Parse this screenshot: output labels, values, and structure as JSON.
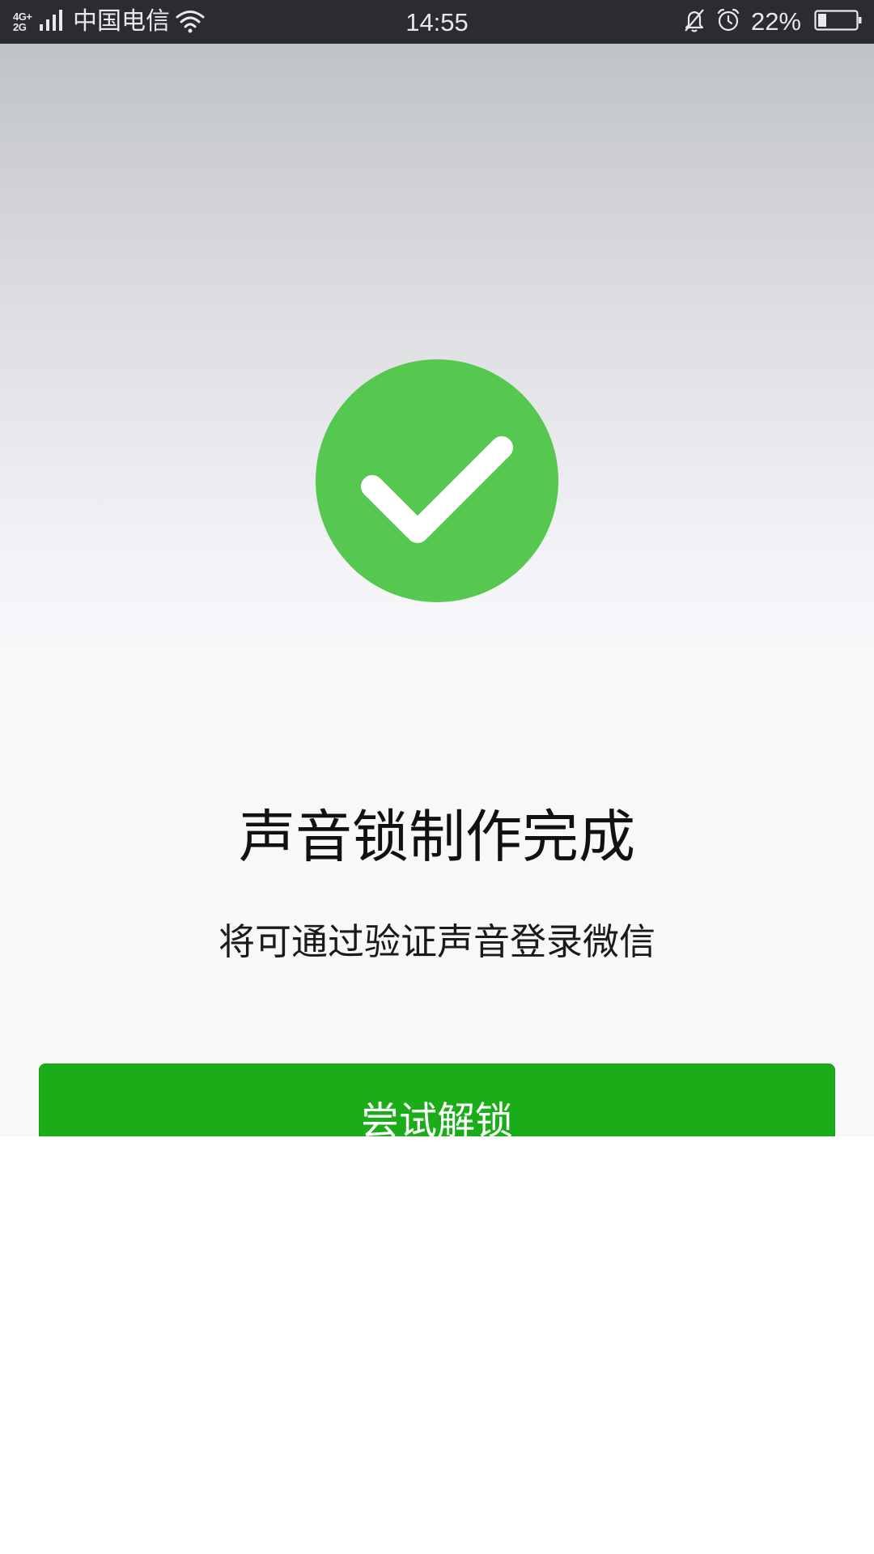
{
  "status_bar": {
    "network_top": "4G+",
    "network_bottom": "2G",
    "carrier": "中国电信",
    "time": "14:55",
    "battery_percent": "22%",
    "battery_level": 0.22,
    "icons": [
      "signal-icon",
      "wifi-icon",
      "bell-muted-icon",
      "alarm-icon",
      "battery-icon"
    ]
  },
  "content": {
    "success_icon": "check-circle-icon",
    "success_color": "#56c84f",
    "title": "声音锁制作完成",
    "subtitle": "将可通过验证声音登录微信",
    "button_label": "尝试解锁",
    "button_color": "#1aad19"
  }
}
